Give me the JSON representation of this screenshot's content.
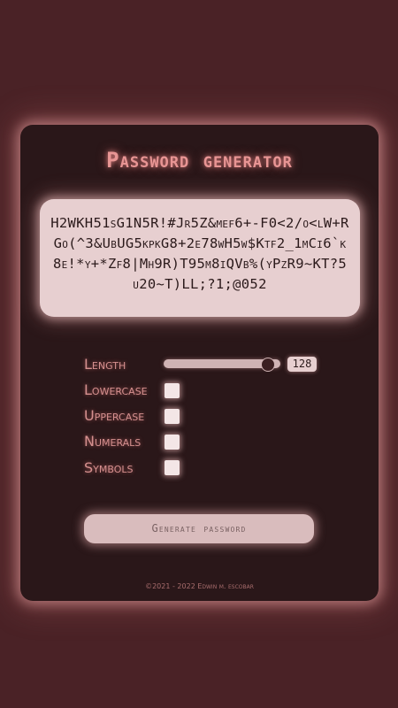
{
  "app": {
    "title": "Password generator"
  },
  "password": {
    "value": "H2WKH51sG1N5R!#Jr5Z&mef6+-F0<2/o<lW+RGo(^3&UbUG5kpkG8+2e78wH5w$Ktf2_1mCi6`k8e!*y+*Zf8|Mh9R)T95m8iQVb%(yPzR9~KT?5u20~T)LL;?1;@052"
  },
  "options": {
    "length": {
      "label": "Length",
      "value": "128",
      "slider_fraction": 0.95
    },
    "lowercase": {
      "label": "Lowercase",
      "checked": false
    },
    "uppercase": {
      "label": "Uppercase",
      "checked": false
    },
    "numerals": {
      "label": "Numerals",
      "checked": false
    },
    "symbols": {
      "label": "Symbols",
      "checked": false
    }
  },
  "actions": {
    "generate_label": "Generate password"
  },
  "footer": {
    "text": "©2021 - 2022 Edwin m. escobar"
  },
  "colors": {
    "background": "#4a2226",
    "card": "#2a1719",
    "accent": "#e89594",
    "password_box": "#e7cfd0"
  }
}
